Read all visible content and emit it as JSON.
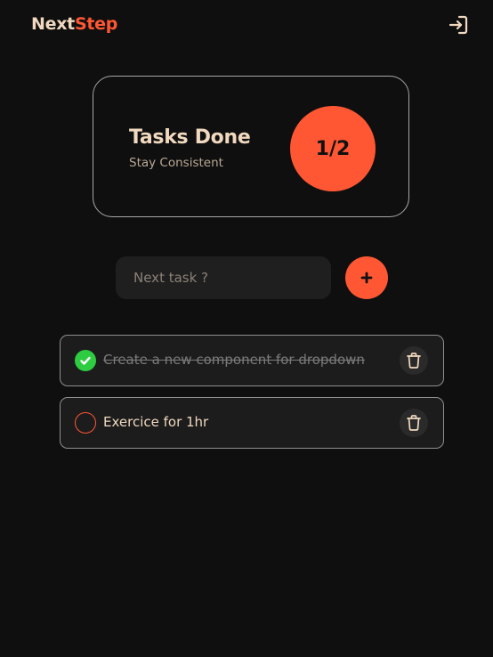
{
  "header": {
    "brand_part1": "Next",
    "brand_part2": "Step",
    "logout_icon": "logout-icon"
  },
  "progress_card": {
    "title": "Tasks Done",
    "subtitle": "Stay Consistent",
    "progress_text": "1/2",
    "completed": 1,
    "total": 2
  },
  "task_input": {
    "placeholder": "Next task ?",
    "value": "",
    "add_icon": "plus-icon"
  },
  "tasks": [
    {
      "text": "Create a new component for dropdown",
      "completed": true
    },
    {
      "text": "Exercice for 1hr",
      "completed": false
    }
  ],
  "colors": {
    "background": "#0f0f0f",
    "accent": "#ff5733",
    "cream": "#f0d9bf",
    "success": "#2ecc40",
    "surface": "#1f1f1f"
  }
}
